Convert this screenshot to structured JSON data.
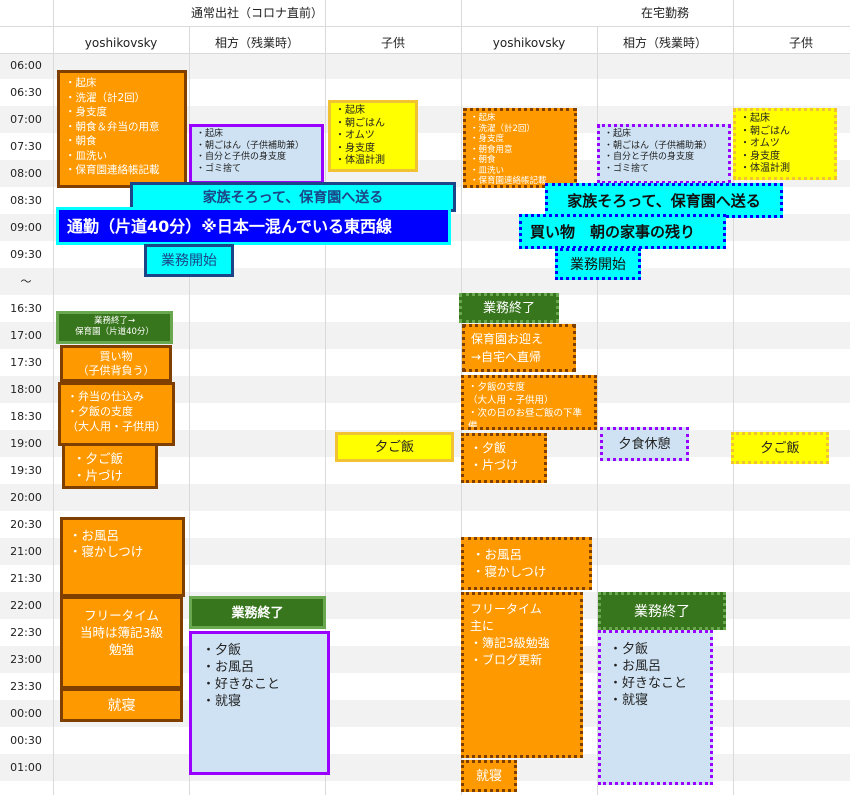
{
  "groups": {
    "office": "通常出社（コロナ直前）",
    "remote": "在宅勤務"
  },
  "columns": [
    "yoshikovsky",
    "相方（残業時）",
    "子供",
    "yoshikovsky",
    "相方（残業時）",
    "子供"
  ],
  "times": [
    "06:00",
    "06:30",
    "07:00",
    "07:30",
    "08:00",
    "08:30",
    "09:00",
    "09:30",
    "～",
    "16:30",
    "17:00",
    "17:30",
    "18:00",
    "18:30",
    "19:00",
    "19:30",
    "20:00",
    "20:30",
    "21:00",
    "21:30",
    "22:00",
    "22:30",
    "23:00",
    "23:30",
    "00:00",
    "00:30",
    "01:00"
  ],
  "blocks": {
    "o1_wake": "・起床\n・洗濯（計2回）\n・身支度\n・朝食＆弁当の用意\n・朝食\n・皿洗い\n・保育園連絡帳記載",
    "o2_morning": "・起床\n・朝ごはん（子供補助兼）\n・自分と子供の身支度\n・ゴミ捨て",
    "o3_child": "・起床\n・朝ごはん\n・オムツ\n・身支度\n・体温計測",
    "o_family": "家族そろって、保育園へ送る",
    "o1_commute": "通勤（片道40分）※日本一混んでいる東西線",
    "o1_work_start": "業務開始",
    "o1_work_end": "業務終了→\n保育園（片道40分）",
    "o1_shopping": "買い物\n（子供背負う）",
    "o1_prep": "・弁当の仕込み\n・夕飯の支度\n（大人用・子供用）",
    "o1_dinner": "・夕ご飯\n・片づけ",
    "o3_dinner": "夕ご飯",
    "o1_bath": "・お風呂\n・寝かしつけ",
    "o1_free": "フリータイム\n当時は簿記3級\n勉強",
    "o1_sleep": "就寝",
    "o2_work_end": "業務終了",
    "o2_night": "・夕飯\n・お風呂\n・好きなこと\n・就寝",
    "r1_wake": "・起床\n・洗濯（計2回）\n・身支度\n・朝食用意\n・朝食\n・皿洗い\n・保育園連絡帳記載",
    "r2_morning": "・起床\n・朝ごはん（子供補助兼）\n・自分と子供の身支度\n・ゴミ捨て",
    "r3_child": "・起床\n・朝ごはん\n・オムツ\n・身支度\n・体温計測",
    "r_family": "家族そろって、保育園へ送る",
    "r_shopping": "買い物　朝の家事の残り",
    "r_work_start": "業務開始",
    "r1_work_end": "業務終了",
    "r1_pickup": "保育園お迎え\n→自宅へ直帰",
    "r1_prep": "・夕飯の支度\n（大人用・子供用）\n・次の日のお昼ご飯の下準備",
    "r1_dinner": "・夕飯\n・片づけ",
    "r2_break": "夕食休憩",
    "r3_dinner": "夕ご飯",
    "r1_bath": "・お風呂\n・寝かしつけ",
    "r1_free": "フリータイム\n主に\n・簿記3級勉強\n・ブログ更新",
    "r1_sleep": "就寝",
    "r2_work_end": "業務終了",
    "r2_night": "・夕飯\n・お風呂\n・好きなこと\n・就寝"
  }
}
